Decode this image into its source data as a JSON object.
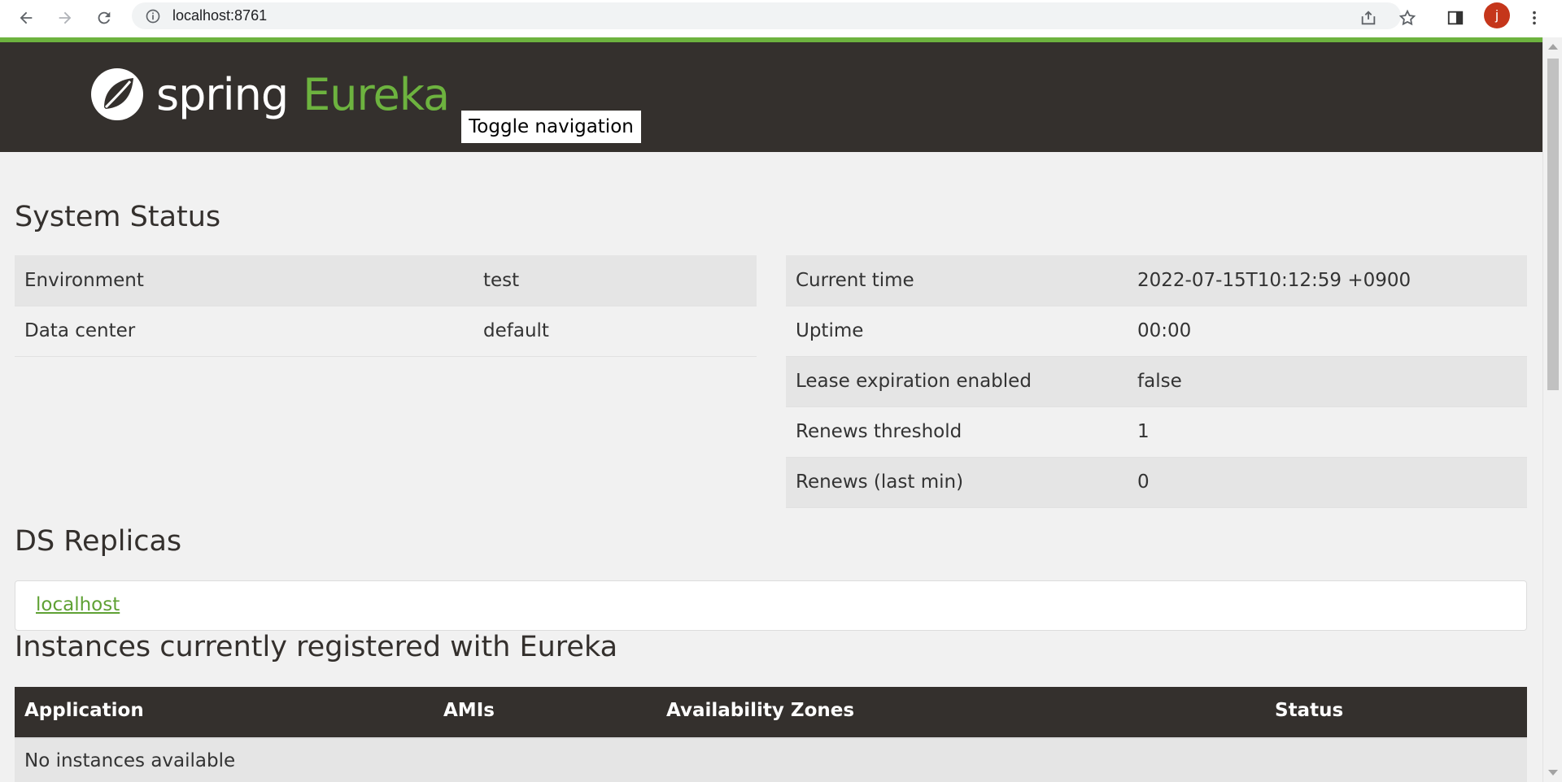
{
  "browser": {
    "url": "localhost:8761",
    "profile_initial": "j"
  },
  "header": {
    "logo_spring": "spring",
    "logo_eureka": "Eureka",
    "toggle_label": "Toggle navigation"
  },
  "system_status": {
    "title": "System Status",
    "left": [
      {
        "label": "Environment",
        "value": "test"
      },
      {
        "label": "Data center",
        "value": "default"
      }
    ],
    "right": [
      {
        "label": "Current time",
        "value": "2022-07-15T10:12:59 +0900"
      },
      {
        "label": "Uptime",
        "value": "00:00"
      },
      {
        "label": "Lease expiration enabled",
        "value": "false"
      },
      {
        "label": "Renews threshold",
        "value": "1"
      },
      {
        "label": "Renews (last min)",
        "value": "0"
      }
    ]
  },
  "ds_replicas": {
    "title": "DS Replicas",
    "link": "localhost"
  },
  "instances": {
    "title": "Instances currently registered with Eureka",
    "columns": [
      "Application",
      "AMIs",
      "Availability Zones",
      "Status"
    ],
    "empty_text": "No instances available"
  },
  "colors": {
    "brand_green": "#6db33f",
    "header_dark": "#34302d"
  }
}
